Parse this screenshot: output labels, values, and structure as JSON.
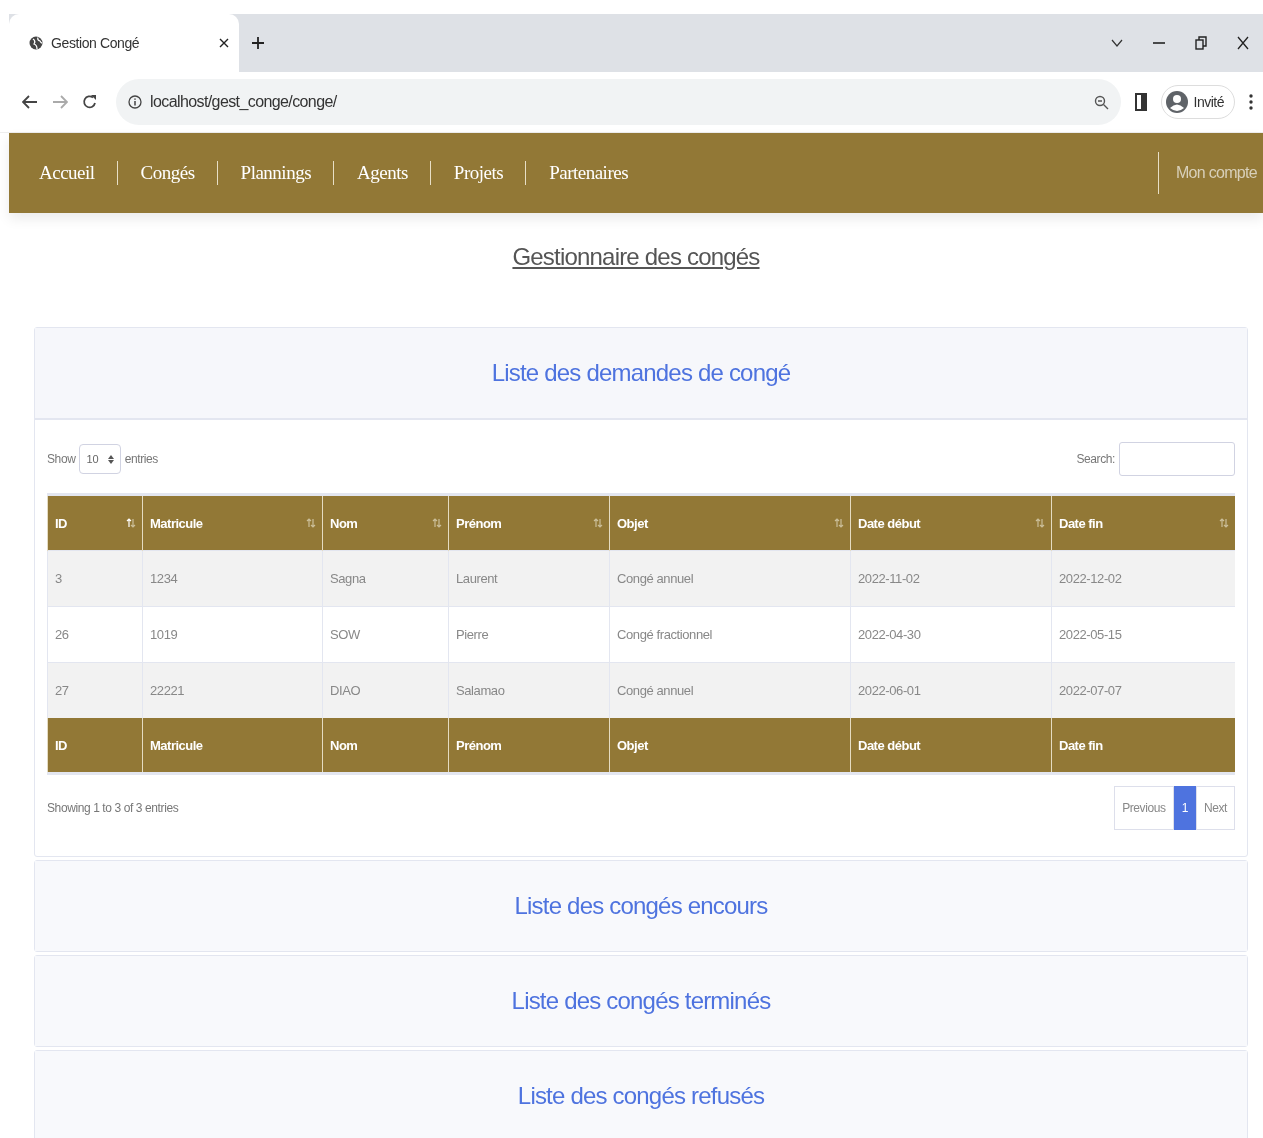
{
  "browser": {
    "tab_title": "Gestion Congé",
    "url": "localhost/gest_conge/conge/",
    "profile": "Invité"
  },
  "nav": {
    "items": [
      {
        "label": "Accueil"
      },
      {
        "label": "Congés"
      },
      {
        "label": "Plannings"
      },
      {
        "label": "Agents"
      },
      {
        "label": "Projets"
      },
      {
        "label": "Partenaires"
      }
    ],
    "account": "Mon compte"
  },
  "page_title": "Gestionnaire des congés",
  "sections": [
    {
      "title": "Liste des demandes de congé",
      "expanded": true,
      "table": {
        "show_label": "Show",
        "length": "10",
        "entries_label": "entries",
        "search_label": "Search:",
        "columns": [
          {
            "label": "ID",
            "sorted": true
          },
          {
            "label": "Matricule",
            "sorted": false
          },
          {
            "label": "Nom",
            "sorted": false
          },
          {
            "label": "Prénom",
            "sorted": false
          },
          {
            "label": "Objet",
            "sorted": false
          },
          {
            "label": "Date début",
            "sorted": false
          },
          {
            "label": "Date fin",
            "sorted": false
          }
        ],
        "rows": [
          [
            "3",
            "1234",
            "Sagna",
            "Laurent",
            "Congé annuel",
            "2022-11-02",
            "2022-12-02"
          ],
          [
            "26",
            "1019",
            "SOW",
            "Pierre",
            "Congé fractionnel",
            "2022-04-30",
            "2022-05-15"
          ],
          [
            "27",
            "22221",
            "DIAO",
            "Salamao",
            "Congé annuel",
            "2022-06-01",
            "2022-07-07"
          ]
        ],
        "footer": [
          "ID",
          "Matricule",
          "Nom",
          "Prénom",
          "Objet",
          "Date début",
          "Date fin"
        ],
        "info": "Showing 1 to 3 of 3 entries",
        "pagination": {
          "previous": "Previous",
          "pages": [
            {
              "label": "1",
              "selected": true
            }
          ],
          "next": "Next"
        }
      }
    },
    {
      "title": "Liste des congés encours",
      "expanded": false
    },
    {
      "title": "Liste des congés terminés",
      "expanded": false
    },
    {
      "title": "Liste des congés refusés",
      "expanded": false
    }
  ]
}
